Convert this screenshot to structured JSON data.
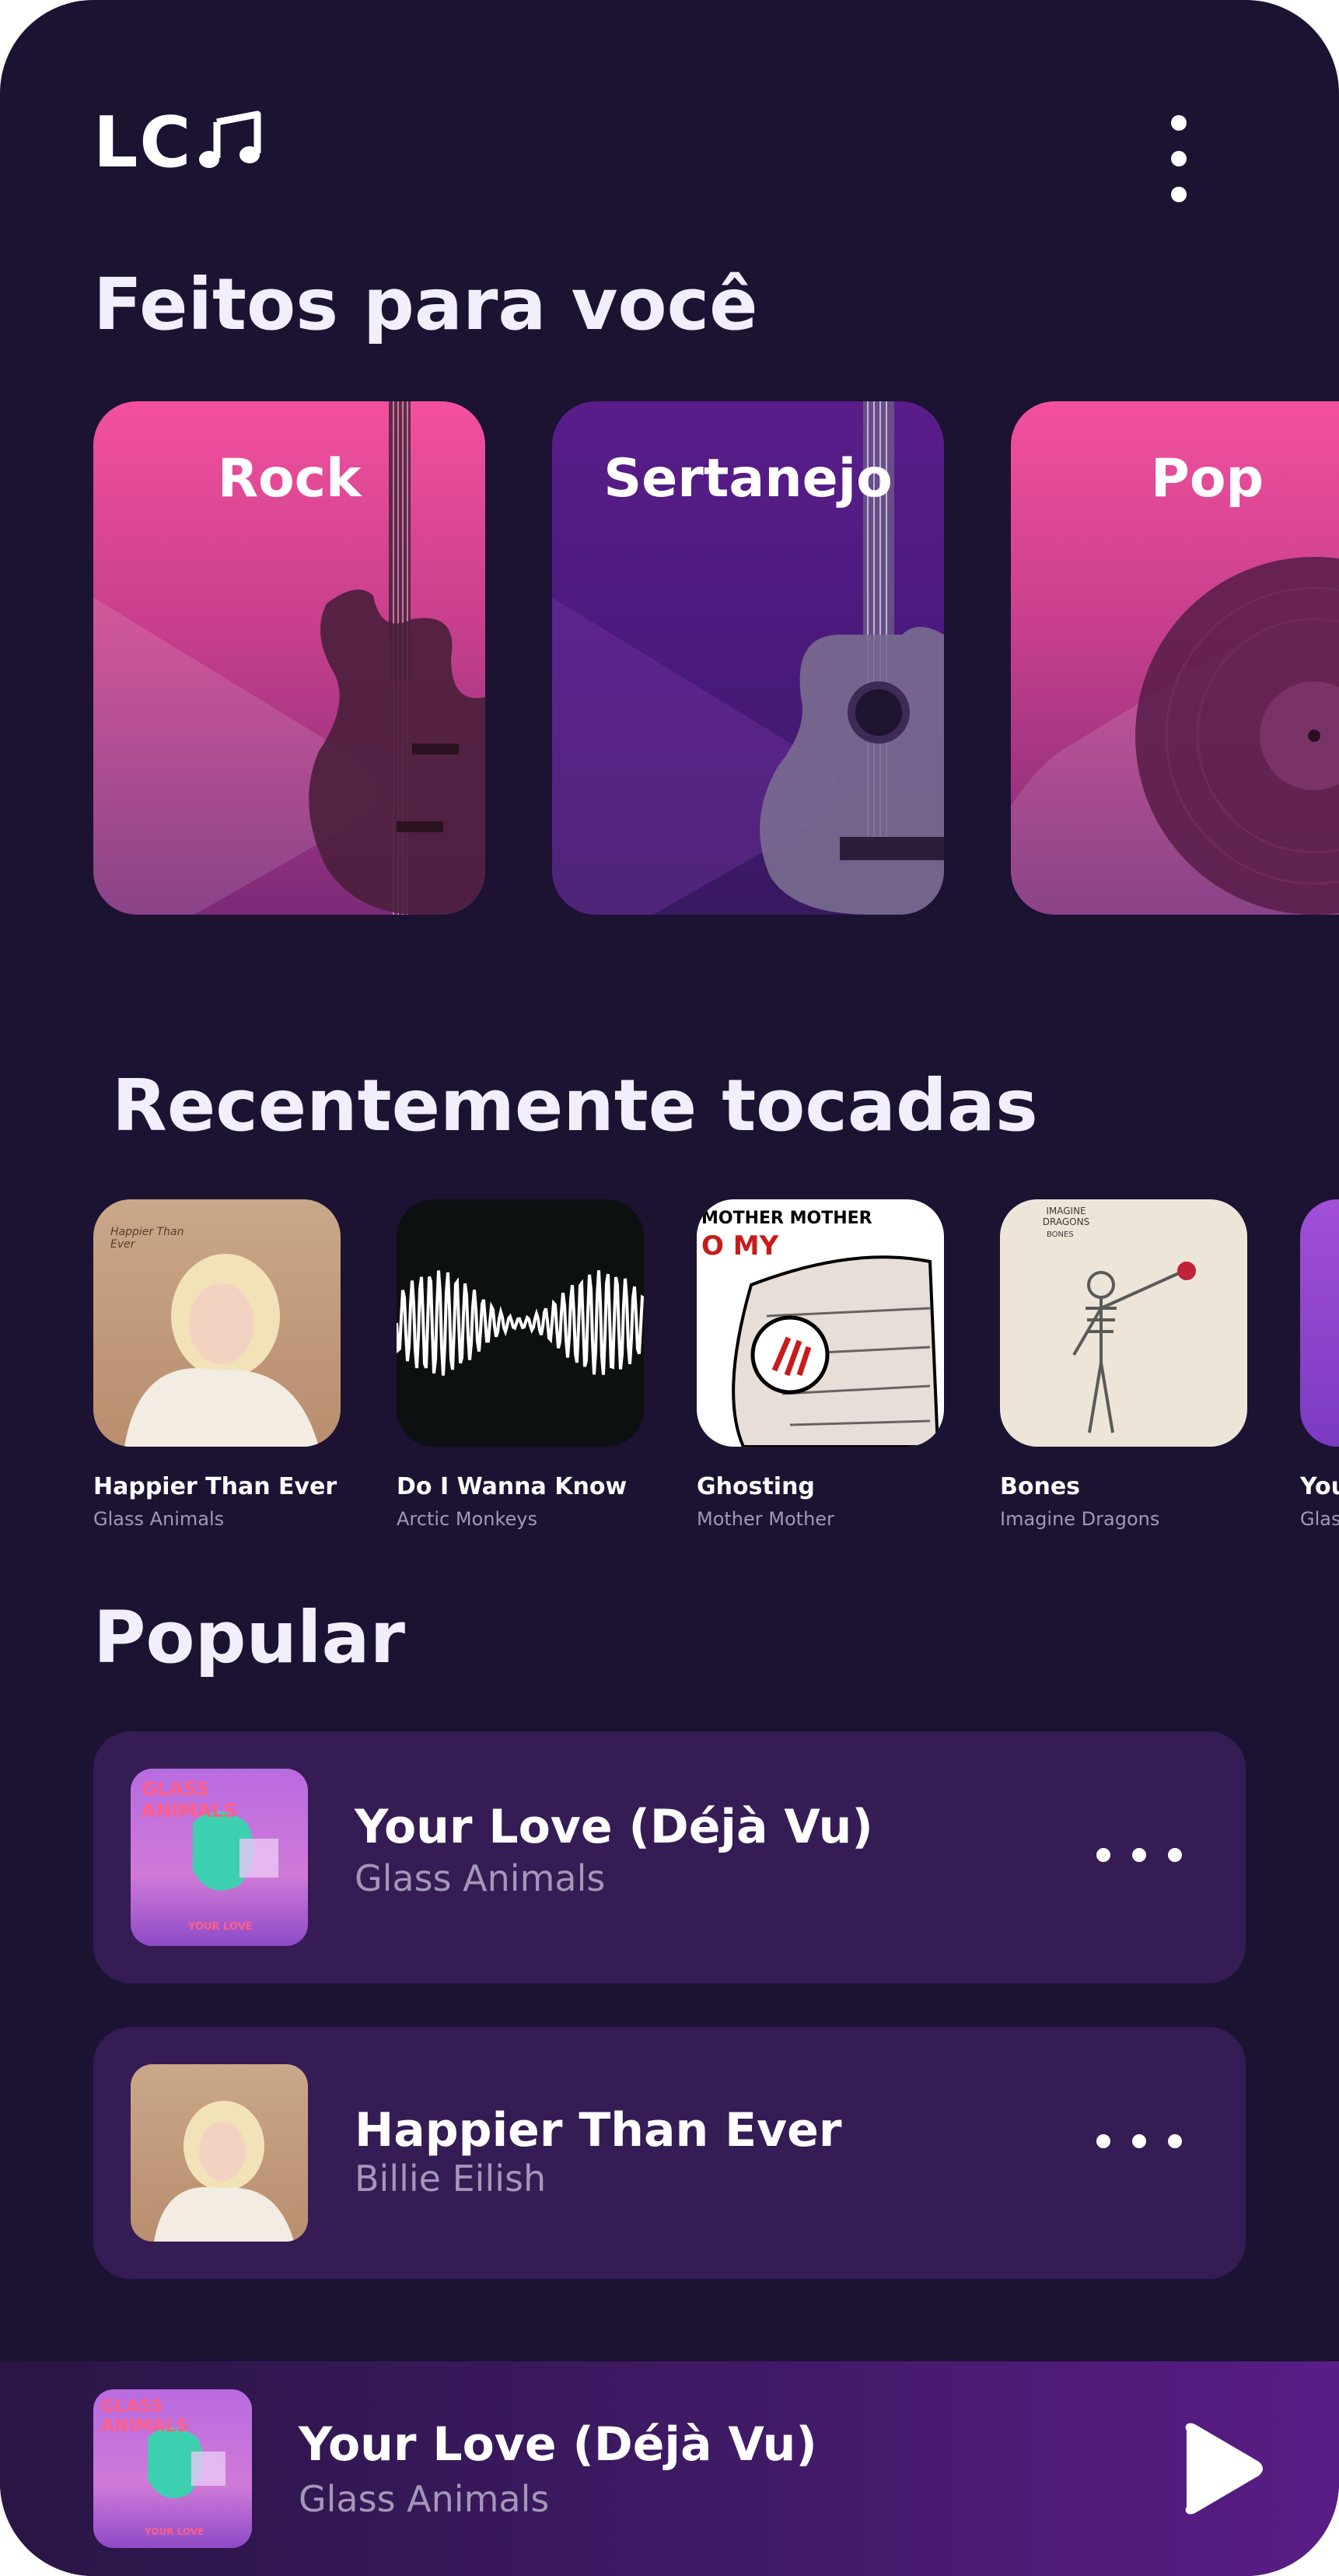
{
  "header": {
    "logo_text": "LC",
    "logo_icon": "music-note-icon",
    "menu_icon": "vertical-dots-icon"
  },
  "made_for_you": {
    "title": "Feitos para você",
    "cards": [
      {
        "label": "Rock",
        "image": "bass-guitar",
        "color": "#f3509e"
      },
      {
        "label": "Sertanejo",
        "image": "acoustic-guitar",
        "color": "#5a1d8a"
      },
      {
        "label": "Pop",
        "image": "vinyl-record",
        "color": "#f3509e"
      }
    ]
  },
  "recently_played": {
    "title": "Recentemente tocadas",
    "items": [
      {
        "title": "Happier Than Ever",
        "artist": "Glass Animals",
        "cover_text": "Happier Than Ever"
      },
      {
        "title": "Do I Wanna Know",
        "artist": "Arctic Monkeys"
      },
      {
        "title": "Ghosting",
        "artist": "Mother Mother",
        "cover_text": "MOTHER MOTHER",
        "cover_text_2": "O MY"
      },
      {
        "title": "Bones",
        "artist": "Imagine Dragons",
        "cover_text": "IMAGINE DRAGONS",
        "cover_text_2": "BONES"
      },
      {
        "title": "You",
        "artist": "Glas"
      }
    ]
  },
  "popular": {
    "title": "Popular",
    "items": [
      {
        "title": "Your Love (Déjà Vu)",
        "artist": "Glass Animals",
        "cover_text": "GLASS ANIMALS",
        "cover_text_2": "YOUR LOVE",
        "more_icon": "horizontal-dots-icon"
      },
      {
        "title": "Happier Than Ever",
        "artist": "Billie Eilish",
        "more_icon": "horizontal-dots-icon"
      }
    ]
  },
  "player": {
    "title": "Your Love (Déjà Vu)",
    "artist": "Glass Animals",
    "cover_text": "GLASS ANIMALS",
    "cover_text_2": "YOUR LOVE",
    "play_icon": "play-icon"
  },
  "colors": {
    "background": "#1c1232",
    "row": "#351c55",
    "pink": "#f3509e",
    "purple": "#5a1d8a",
    "muted_text": "#a397b8"
  }
}
